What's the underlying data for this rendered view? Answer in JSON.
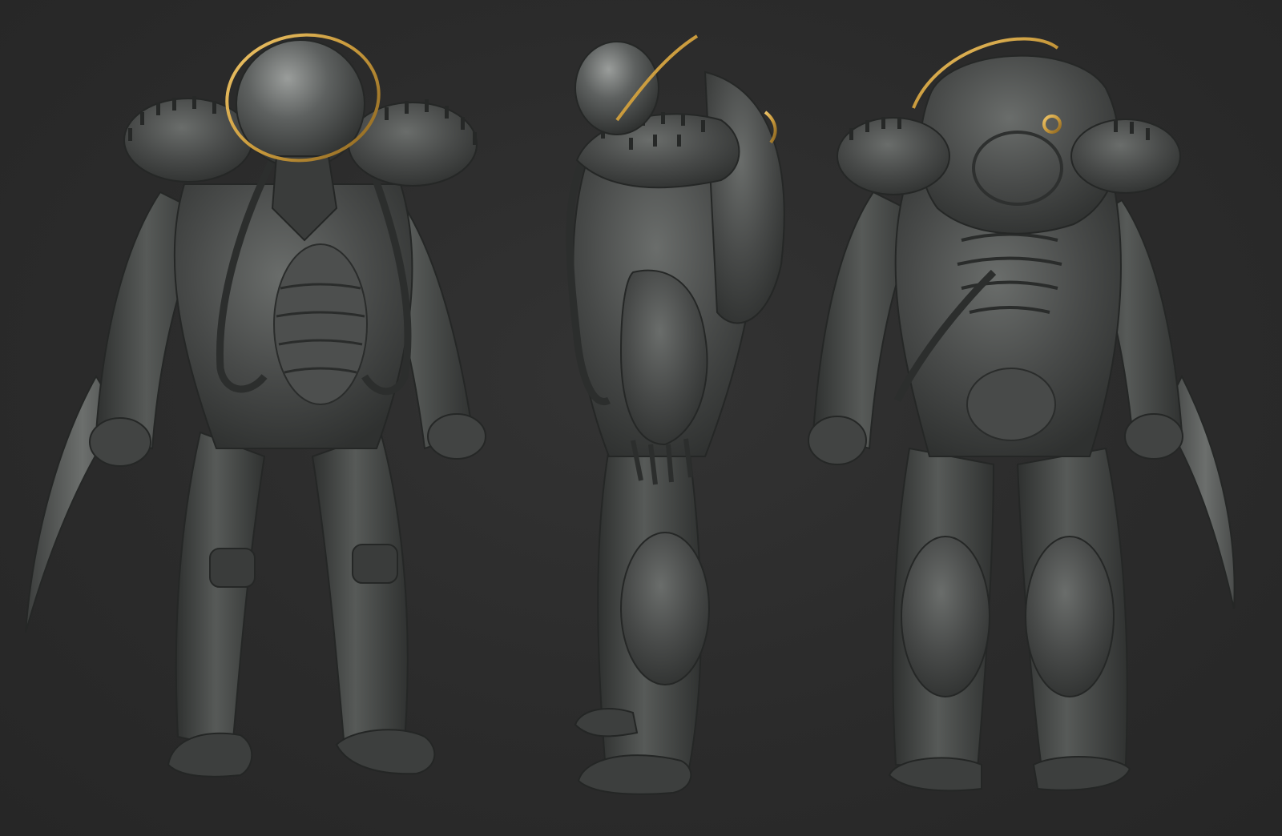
{
  "scene": {
    "background_color": "#2b2b2b",
    "body_color": "#4a4c4b",
    "body_shadow_color": "#2e302f",
    "body_highlight_color": "#6f7270",
    "accent_color": "#c99a3c",
    "views": [
      {
        "name": "front-view",
        "helmet": "dome-front",
        "blade_side": "left"
      },
      {
        "name": "side-view",
        "helmet": "dome-profile",
        "blade_side": "none"
      },
      {
        "name": "back-view",
        "helmet": "back-shell",
        "blade_side": "right"
      }
    ]
  }
}
